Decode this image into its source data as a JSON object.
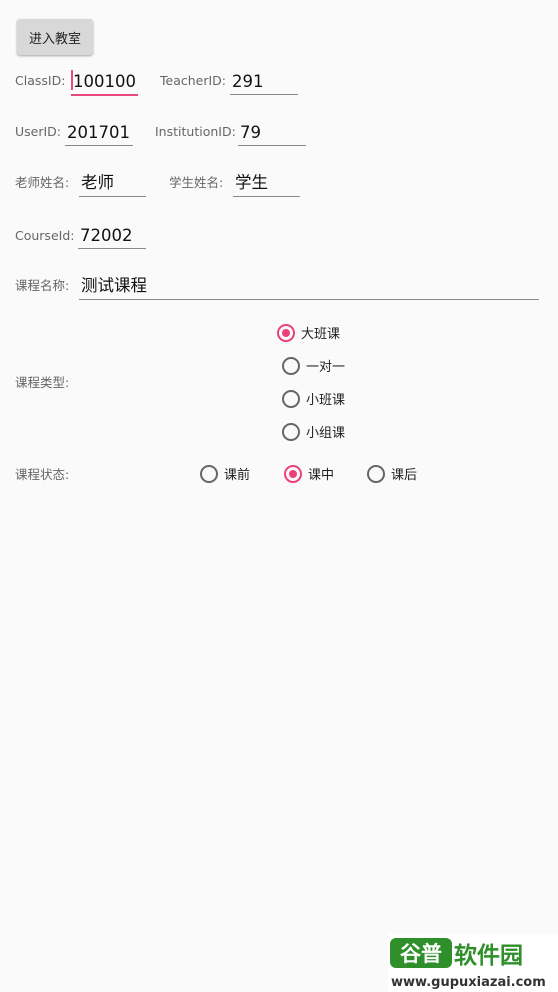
{
  "enter_button": "进入教室",
  "class_id": {
    "label": "ClassID:",
    "value": "100100"
  },
  "teacher_id": {
    "label": "TeacherID:",
    "value": "291"
  },
  "user_id": {
    "label": "UserID:",
    "value": "201701"
  },
  "institution_id": {
    "label": "InstitutionID:",
    "value": "79"
  },
  "teacher_name": {
    "label": "老师姓名:",
    "value": "老师"
  },
  "student_name": {
    "label": "学生姓名:",
    "value": "学生"
  },
  "course_id": {
    "label": "CourseId:",
    "value": "72002"
  },
  "course_name": {
    "label": "课程名称:",
    "value": "测试课程"
  },
  "course_type": {
    "label": "课程类型:",
    "options": [
      "大班课",
      "一对一",
      "小班课",
      "小组课"
    ],
    "selected": "大班课"
  },
  "course_status": {
    "label": "课程状态:",
    "options": [
      "课前",
      "课中",
      "课后"
    ],
    "selected": "课中"
  },
  "watermark": {
    "title": "谷普软件园",
    "url": "www.gupuxiazai.com"
  },
  "colors": {
    "accent": "#ec407a",
    "background": "#fafafa",
    "watermark_green": "#2f8f2a"
  }
}
